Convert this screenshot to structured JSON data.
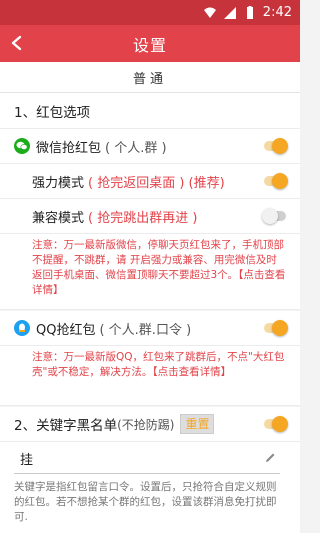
{
  "status_bar": {
    "time": "2:42"
  },
  "header": {
    "title": "设置"
  },
  "section": {
    "title": "普通"
  },
  "redpacket": {
    "heading": "1、红包选项",
    "wechat": {
      "label": "微信抢红包",
      "paren": "( 个人.群 )",
      "enabled": true
    },
    "strong_mode": {
      "label": "强力模式",
      "paren": "( 抢完返回桌面 ) (推荐)",
      "enabled": true
    },
    "compat_mode": {
      "label": "兼容模式",
      "paren": "( 抢完跳出群再进 )",
      "enabled": false
    },
    "wechat_note": "注意：万一最新版微信，停聊天页红包来了，手机顶部不提醒，不跳群，请 开启强力或兼容、用完微信及时返回手机桌面、微信置顶聊天不要超过3个。【点击查看详情】",
    "qq": {
      "label": "QQ抢红包",
      "paren": "( 个人.群.口令 )",
      "enabled": true
    },
    "qq_note": "注意：万一最新版QQ，红包来了跳群后，不点\"大红包壳\"或不稳定，解决方法。【点击查看详情】"
  },
  "keyword": {
    "heading": "2、关键字黑名单",
    "paren": "(不抢防踢)",
    "reset_label": "重置",
    "enabled": true,
    "value": "挂",
    "help": "关键字是指红包留言口令。设置后，只抢符合自定义规则的红包。若不想抢某个群的红包，设置该群消息免打扰即可."
  },
  "colors": {
    "primary": "#e2434a",
    "toggle_on": "#f5a623"
  }
}
